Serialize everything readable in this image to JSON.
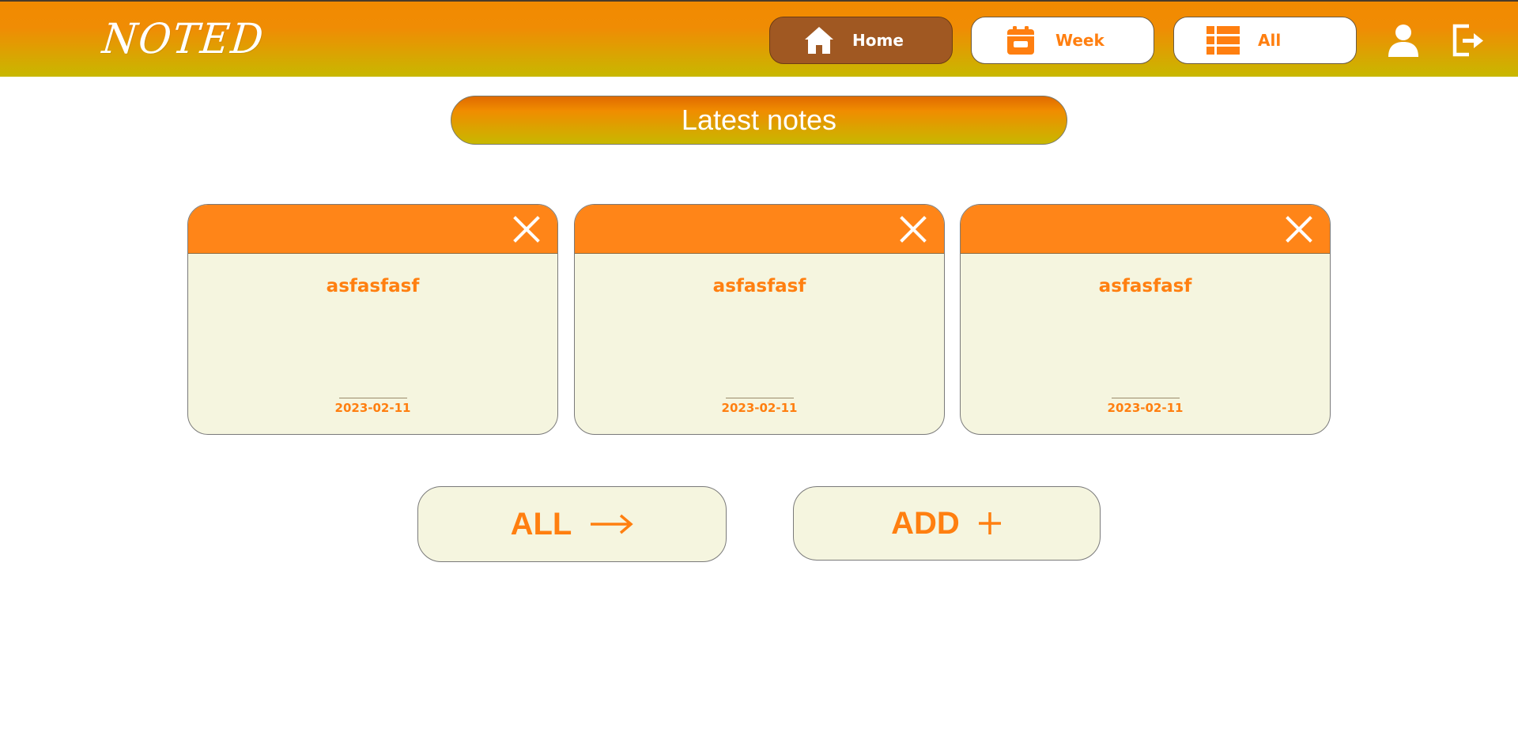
{
  "app": {
    "logo_text": "NOTED"
  },
  "nav": {
    "home_label": "Home",
    "week_label": "Week",
    "all_label": "All"
  },
  "icons": {
    "home": "home-icon",
    "week": "calendar-icon",
    "all": "list-icon",
    "user": "user-icon",
    "logout": "logout-icon",
    "close": "close-icon",
    "arrow": "arrow-right-icon",
    "plus": "plus-icon"
  },
  "colors": {
    "accent": "#ff7f10",
    "header_top": "#f28a00",
    "header_bottom": "#c8b800",
    "active_nav": "#a05822",
    "card_bg": "#f5f5df",
    "card_head": "#ff8518"
  },
  "main": {
    "heading": "Latest notes",
    "notes": [
      {
        "title": "asfasfasf",
        "date": "2023-02-11"
      },
      {
        "title": "asfasfasf",
        "date": "2023-02-11"
      },
      {
        "title": "asfasfasf",
        "date": "2023-02-11"
      }
    ],
    "all_button_label": "ALL",
    "add_button_label": "ADD"
  }
}
